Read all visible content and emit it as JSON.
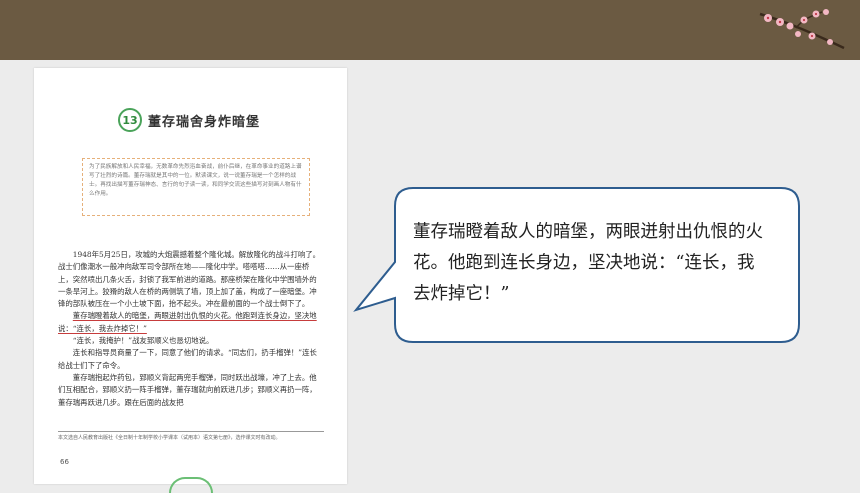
{
  "lesson": {
    "number": "13",
    "title": "董存瑞舍身炸暗堡"
  },
  "intro": "为了民族解放和人民幸福，无数革命先烈浴血奋战，前仆后继，在革命事业的道路上谱写了壮烈的诗篇。董存瑞就是其中的一位。默读课文，说一说董存瑞是一个怎样的战士。再找出描写董存瑞神态、言行的句子读一读，和同学交流这些描写对刻画人物有什么作用。",
  "paragraphs": [
    "1948年5月25日，攻城的大炮震撼着整个隆化城。解放隆化的战斗打响了。战士们像潮水一般冲向敌军司令部所在地——隆化中学。嗒嗒嗒……从一座桥上，突然喷出几条火舌，封锁了我军前进的道路。那座桥架在隆化中学围墙外的一条旱河上。狡猾的敌人在桥的两侧筑了墙，顶上加了盖，构成了一座暗堡。冲锋的部队被压在一个小土坡下面，抬不起头。冲在最前面的一个战士倒下了。",
    "董存瑞瞪着敌人的暗堡，两眼迸射出仇恨的火花。他跑到连长身边，坚决地说：“连长，我去炸掉它！”",
    "“连长，我掩护！”战友郅顺义也恳切地说。",
    "连长和指导员商量了一下，同意了他们的请求。“同志们，扔手榴弹！”连长给战士们下了命令。",
    "董存瑞抱起炸药包，郅顺义背起两兜手榴弹，同时跃出战壕，冲了上去。他们互相配合，郅顺义扔一阵手榴弹，董存瑞就向前跃进几步；郅顺义再扔一阵，董存瑞再跃进几步。跟在后面的战友把"
  ],
  "footnote": "本文选自人民教育出版社《全日制十年制学校小学课本（试用本）语文第七册》，选作课文时有改动。",
  "page_number": "66",
  "callout": "董存瑞瞪着敌人的暗堡，两眼迸射出仇恨的火花。他跑到连长身边，坚决地说：“连长，我去炸掉它！”"
}
